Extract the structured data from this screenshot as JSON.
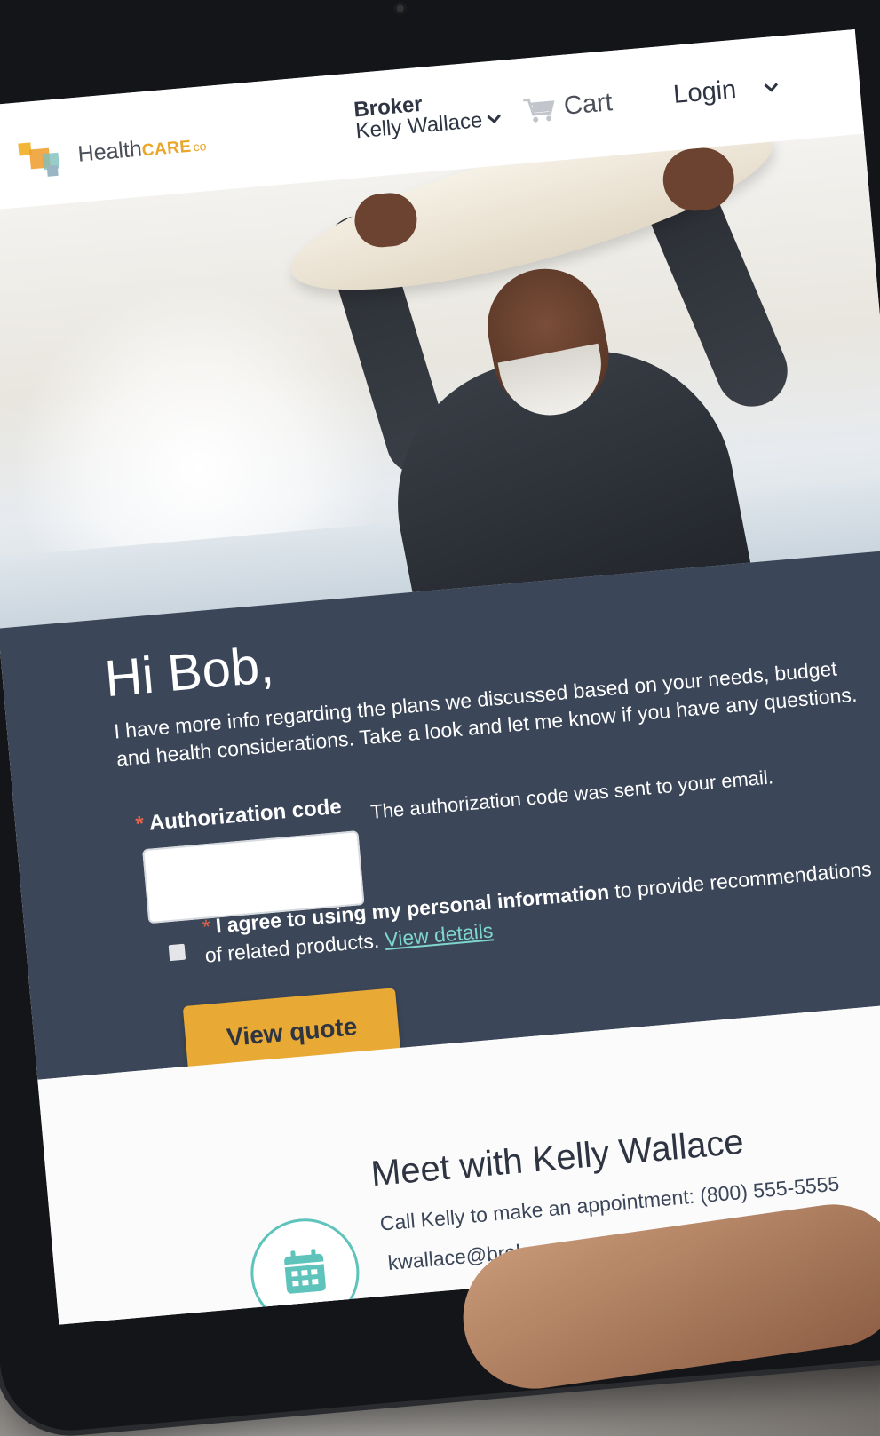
{
  "header": {
    "logo_word": "Health",
    "logo_care": "CARE",
    "logo_co": "co",
    "broker_role": "Broker",
    "broker_name": "Kelly Wallace",
    "cart_label": "Cart",
    "login_label": "Login"
  },
  "hero": {
    "image_subject": "smiling-surfer-with-board"
  },
  "message": {
    "greeting": "Hi Bob,",
    "body": "I have more info regarding the plans we discussed based on your needs, budget and health considerations. Take a look and let me know if you have any questions."
  },
  "auth": {
    "required_mark": "*",
    "label": "Authorization code",
    "value": "",
    "hint": "The authorization code was sent to your email."
  },
  "consent": {
    "required_mark": "*",
    "bold_text": "I agree to using my personal information",
    "text_after": "to provide recommendations",
    "text_line2": "of related products.",
    "link_text": "View details",
    "checked": false
  },
  "cta": {
    "label": "View quote"
  },
  "meet": {
    "title": "Meet with Kelly Wallace",
    "call_text": "Call Kelly to make an appointment: (800) 555-5555",
    "email": "kwallace@brokeragency.com"
  },
  "colors": {
    "panel": "#3b4658",
    "accent": "#e8a935",
    "teal": "#5ec3bb",
    "required": "#e0624b"
  },
  "icons": [
    "cart-icon",
    "chevron-down-icon",
    "calendar-icon"
  ]
}
